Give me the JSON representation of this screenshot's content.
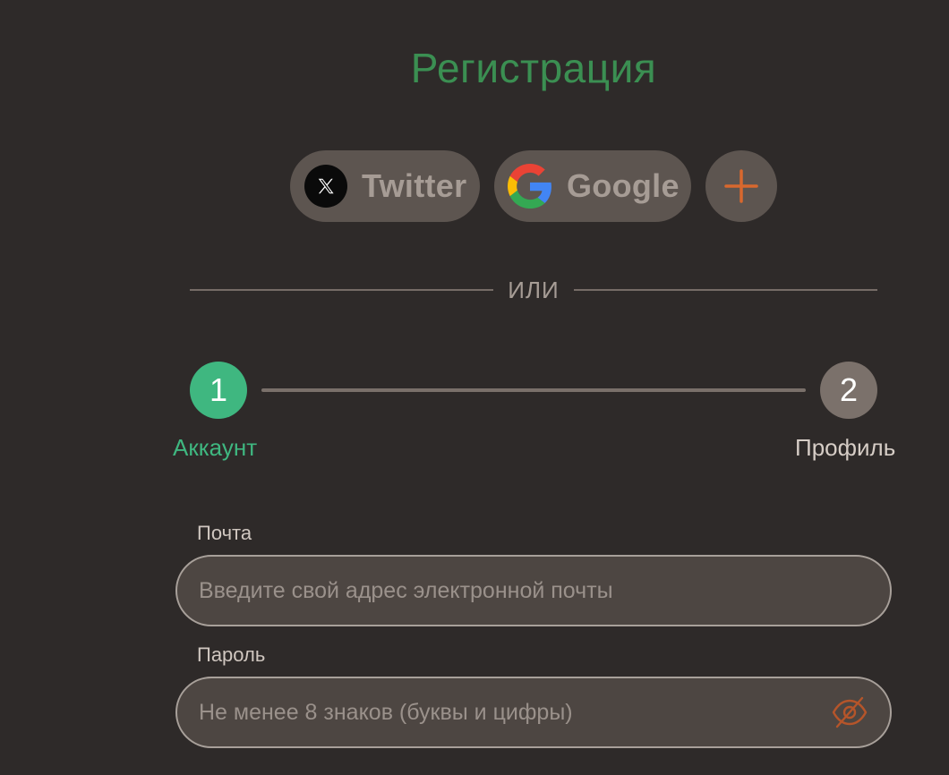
{
  "title": "Регистрация",
  "social": {
    "twitter_label": "Twitter",
    "google_label": "Google",
    "more_icon": "plus-icon"
  },
  "divider": {
    "or_text": "ИЛИ"
  },
  "steps": [
    {
      "number": "1",
      "label": "Аккаунт",
      "state": "active"
    },
    {
      "number": "2",
      "label": "Профиль",
      "state": "inactive"
    }
  ],
  "form": {
    "email": {
      "label": "Почта",
      "value": "",
      "placeholder": "Введите свой адрес электронной почты"
    },
    "password": {
      "label": "Пароль",
      "value": "",
      "placeholder": "Не менее 8 знаков (буквы и цифры)",
      "toggle_icon": "eye-off-icon"
    }
  },
  "colors": {
    "background": "#2e2a29",
    "title": "#3b8f52",
    "active_step": "#3fb780",
    "inactive_step": "#7b716b",
    "accent_orange": "#d8682e",
    "button_bg": "#5d5550"
  }
}
